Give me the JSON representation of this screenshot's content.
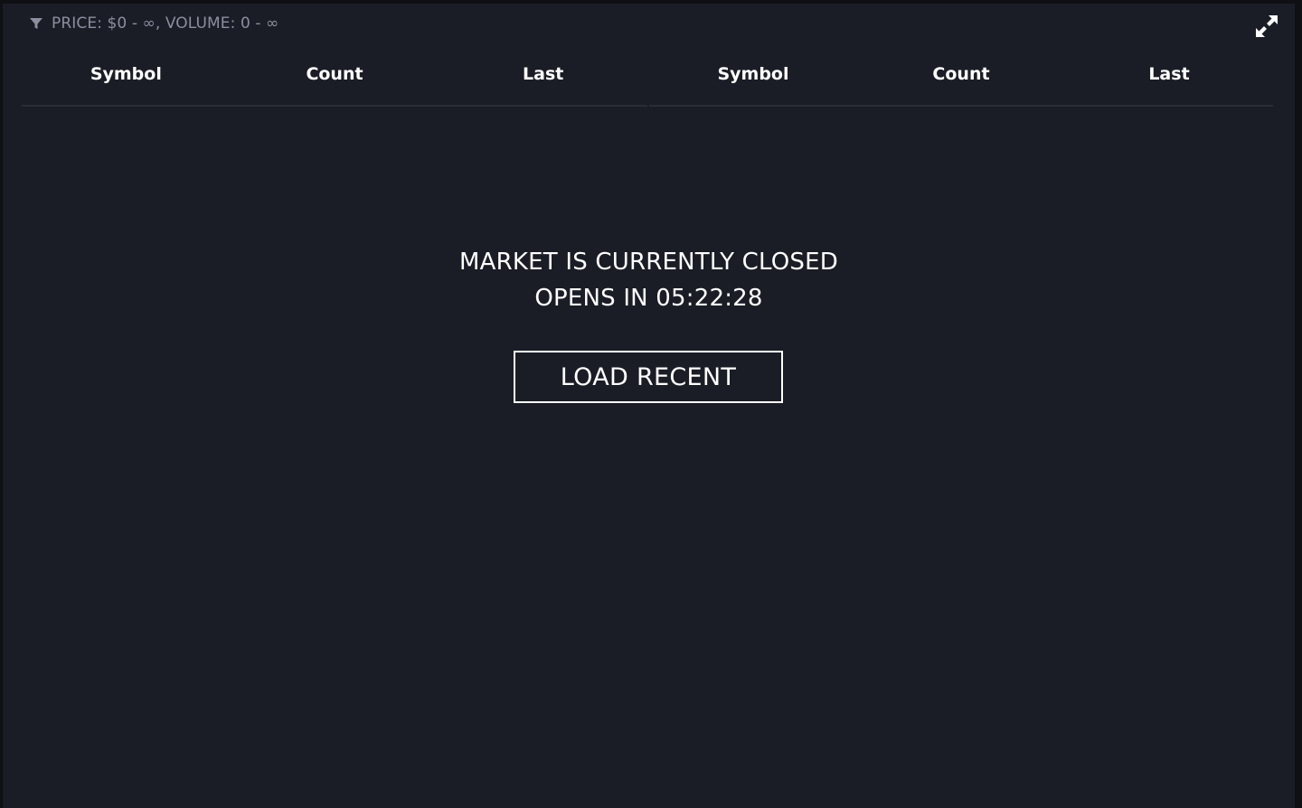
{
  "filter": {
    "icon": "filter-icon",
    "label": "PRICE: $0 - ∞, VOLUME: 0 - ∞"
  },
  "expand": {
    "icon": "expand-icon"
  },
  "table_left": {
    "columns": [
      "Symbol",
      "Count",
      "Last"
    ]
  },
  "table_right": {
    "columns": [
      "Symbol",
      "Count",
      "Last"
    ]
  },
  "status": {
    "line1": "MARKET IS CURRENTLY CLOSED",
    "line2": "OPENS IN 05:22:28"
  },
  "load_button": {
    "label": "LOAD RECENT"
  },
  "colors": {
    "panel_bg": "#1b1d26",
    "text": "#ffffff",
    "muted": "#8b8e9f",
    "divider": "#2a2d38"
  }
}
